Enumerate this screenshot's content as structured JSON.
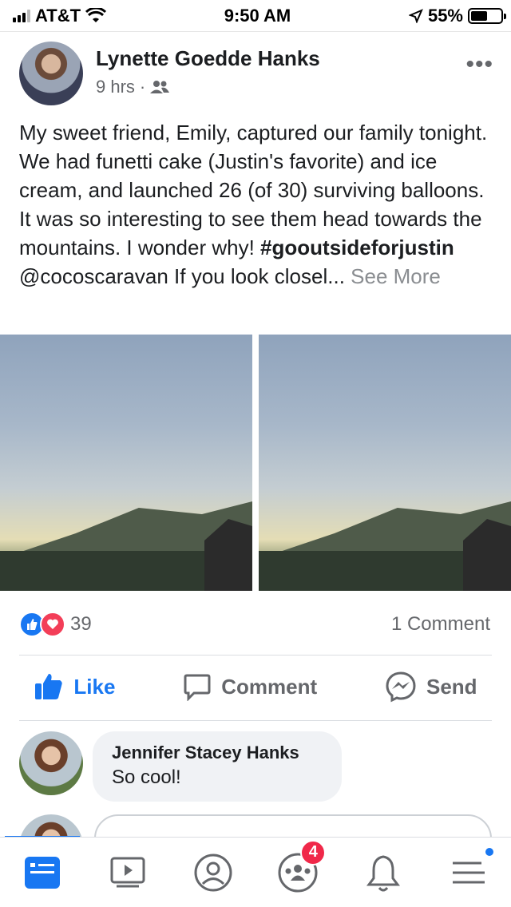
{
  "status_bar": {
    "carrier": "AT&T",
    "time": "9:50 AM",
    "battery_percent": "55%",
    "battery_level": 0.55,
    "icons": [
      "signal-icon",
      "wifi-icon",
      "location-icon",
      "battery-icon"
    ]
  },
  "post": {
    "author": "Lynette Goedde Hanks",
    "time": "9 hrs",
    "separator": "·",
    "audience_icon": "friends-icon",
    "text_body": "My sweet friend,  Emily, captured our family tonight. We had funetti cake (Justin's favorite) and ice cream, and launched  26 (of 30) surviving balloons. It was so interesting to see them head towards the mountains. I wonder why! ",
    "hashtag": "#gooutsideforjustin",
    "text_tail": "@cocoscaravan If you look closel...",
    "see_more": "See More"
  },
  "reactions": {
    "count": "39",
    "comments": "1 Comment",
    "icons": [
      "like-reaction-icon",
      "love-reaction-icon"
    ]
  },
  "actions": {
    "like": "Like",
    "comment": "Comment",
    "send": "Send"
  },
  "comment": {
    "name": "Jennifer Stacey Hanks",
    "text": "So cool!"
  },
  "tabbar": {
    "items": [
      "news-feed-icon",
      "watch-icon",
      "profile-icon",
      "groups-icon",
      "notifications-icon",
      "menu-icon"
    ],
    "groups_badge": "4"
  },
  "colors": {
    "brand": "#1877f2",
    "badge": "#f02849",
    "love": "#f33e58"
  }
}
